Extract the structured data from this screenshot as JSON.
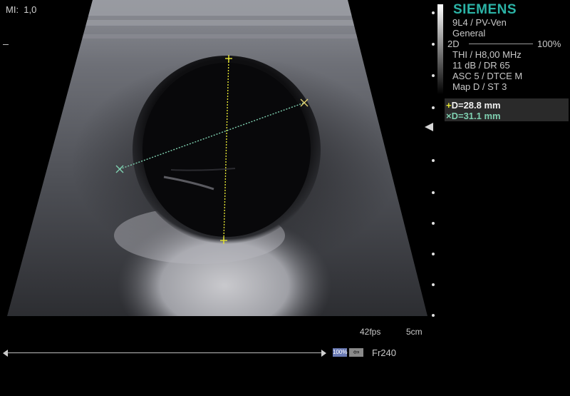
{
  "header": {
    "mi_label": "MI:",
    "mi_value": "1,0"
  },
  "brand": "SIEMENS",
  "probe": {
    "transducer": "9L4 / PV-Ven",
    "preset": "General"
  },
  "mode": {
    "label": "2D",
    "power": "100%"
  },
  "settings": [
    "THI / H8,00 MHz",
    "11 dB / DR 65",
    "ASC 5 / DTCE M",
    "Map D / ST 3"
  ],
  "measurements": [
    {
      "label": "D=28.8 mm",
      "marker": "+",
      "color": "#e6e634"
    },
    {
      "label": "D=31.1 mm",
      "marker": "×",
      "color": "#7fd0b0"
    }
  ],
  "footer": {
    "fps": "42fps",
    "depth": "5cm",
    "zoom": "100%",
    "back_arrow": "⇦",
    "frame": "Fr240"
  },
  "colors": {
    "brand": "#2bb3a6",
    "caliper_1": "#e6e634",
    "caliper_2": "#7fd0b0",
    "background": "#000000"
  }
}
